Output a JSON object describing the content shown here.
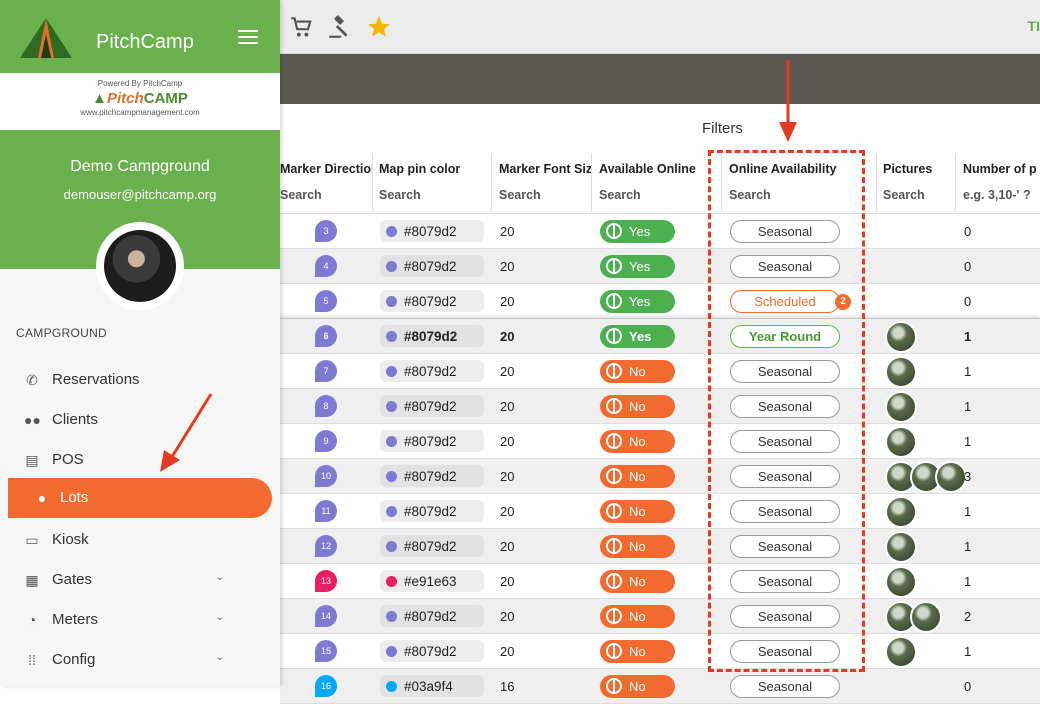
{
  "app": {
    "brand": "PitchCamp"
  },
  "powered": {
    "line1": "Powered By PitchCamp",
    "logo_a": "Pitch",
    "logo_b": "CAMP",
    "site": "www.pitchcampmanagement.com"
  },
  "user": {
    "campground": "Demo Campground",
    "email": "demouser@pitchcamp.org"
  },
  "topbar": {
    "right_text": "TI",
    "icons": [
      "cart-icon",
      "gavel-icon",
      "star-icon"
    ]
  },
  "sidebar": {
    "section": "CAMPGROUND",
    "items": [
      {
        "label": "Reservations",
        "icon": "phone-icon"
      },
      {
        "label": "Clients",
        "icon": "people-icon"
      },
      {
        "label": "POS",
        "icon": "register-icon"
      },
      {
        "label": "Lots",
        "icon": "pin-icon",
        "active": true
      },
      {
        "label": "Kiosk",
        "icon": "kiosk-icon"
      },
      {
        "label": "Gates",
        "icon": "gate-icon",
        "expandable": true
      },
      {
        "label": "Meters",
        "icon": "meter-icon",
        "expandable": true
      },
      {
        "label": "Config",
        "icon": "grid-icon",
        "expandable": true
      }
    ]
  },
  "filters_title": "Filters",
  "table": {
    "columns": [
      {
        "header": "Marker Direction",
        "search": "Search"
      },
      {
        "header": "Map pin color",
        "search": "Search"
      },
      {
        "header": "Marker Font Size",
        "search": "Search"
      },
      {
        "header": "Available Online",
        "search": "Search"
      },
      {
        "header": "Online Availability",
        "search": "Search"
      },
      {
        "header": "Pictures",
        "search": "Search"
      },
      {
        "header": "Number of p",
        "search": "e.g. 3,10-' ?"
      }
    ],
    "rows": [
      {
        "marker": "3",
        "color": "#8079d2",
        "font": "20",
        "online": "Yes",
        "avail": "Seasonal",
        "pics": 0,
        "num": "0"
      },
      {
        "marker": "4",
        "color": "#8079d2",
        "font": "20",
        "online": "Yes",
        "avail": "Seasonal",
        "pics": 0,
        "num": "0"
      },
      {
        "marker": "5",
        "color": "#8079d2",
        "font": "20",
        "online": "Yes",
        "avail": "Scheduled",
        "badge": "2",
        "pics": 0,
        "num": "0"
      },
      {
        "marker": "6",
        "color": "#8079d2",
        "font": "20",
        "online": "Yes",
        "avail": "Year Round",
        "pics": 1,
        "num": "1"
      },
      {
        "marker": "7",
        "color": "#8079d2",
        "font": "20",
        "online": "No",
        "avail": "Seasonal",
        "pics": 1,
        "num": "1"
      },
      {
        "marker": "8",
        "color": "#8079d2",
        "font": "20",
        "online": "No",
        "avail": "Seasonal",
        "pics": 1,
        "num": "1"
      },
      {
        "marker": "9",
        "color": "#8079d2",
        "font": "20",
        "online": "No",
        "avail": "Seasonal",
        "pics": 1,
        "num": "1"
      },
      {
        "marker": "10",
        "color": "#8079d2",
        "font": "20",
        "online": "No",
        "avail": "Seasonal",
        "pics": 3,
        "num": "3"
      },
      {
        "marker": "11",
        "color": "#8079d2",
        "font": "20",
        "online": "No",
        "avail": "Seasonal",
        "pics": 1,
        "num": "1"
      },
      {
        "marker": "12",
        "color": "#8079d2",
        "font": "20",
        "online": "No",
        "avail": "Seasonal",
        "pics": 1,
        "num": "1"
      },
      {
        "marker": "13",
        "color": "#e91e63",
        "font": "20",
        "online": "No",
        "avail": "Seasonal",
        "pics": 1,
        "num": "1"
      },
      {
        "marker": "14",
        "color": "#8079d2",
        "font": "20",
        "online": "No",
        "avail": "Seasonal",
        "pics": 2,
        "num": "2"
      },
      {
        "marker": "15",
        "color": "#8079d2",
        "font": "20",
        "online": "No",
        "avail": "Seasonal",
        "pics": 1,
        "num": "1"
      },
      {
        "marker": "16",
        "color": "#03a9f4",
        "font": "16",
        "online": "No",
        "avail": "Seasonal",
        "pics": 0,
        "num": "0"
      }
    ]
  },
  "colors": {
    "green": "#6ab04c",
    "orange": "#f26a2e",
    "annotation": "#e53a1f"
  }
}
